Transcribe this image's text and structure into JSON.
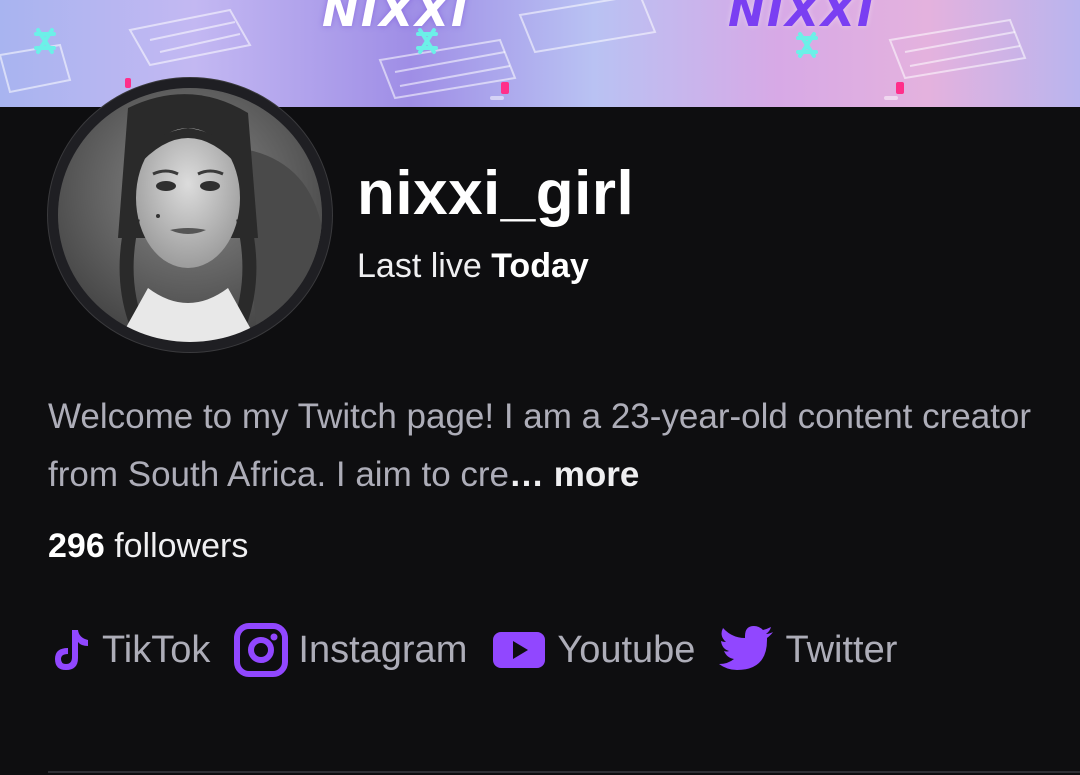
{
  "banner": {
    "wordmark_left": "NIXXI",
    "wordmark_right": "NIXXI"
  },
  "profile": {
    "display_name": "nixxi_girl",
    "last_live_prefix": "Last live",
    "last_live_value": "Today",
    "bio_text": "Welcome to my Twitch page! I am a 23-year-old content creator from South Africa. I aim to cre",
    "bio_ellipsis": "…",
    "bio_more_label": "more",
    "followers_count": "296",
    "followers_label": "followers"
  },
  "socials": [
    {
      "icon": "tiktok-icon",
      "label": "TikTok"
    },
    {
      "icon": "instagram-icon",
      "label": "Instagram"
    },
    {
      "icon": "youtube-icon",
      "label": "Youtube"
    },
    {
      "icon": "twitter-icon",
      "label": "Twitter"
    }
  ],
  "colors": {
    "background": "#0e0e10",
    "accent": "#9147ff",
    "muted_text": "#adadb8",
    "primary_text": "#efeff1"
  }
}
